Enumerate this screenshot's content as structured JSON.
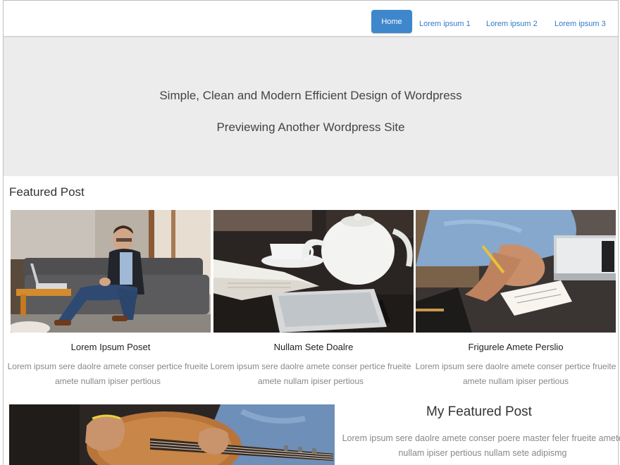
{
  "nav": {
    "home": "Home",
    "links": [
      "Lorem ipsum  1",
      "Lorem ipsum  2",
      "Lorem ipsum  3"
    ]
  },
  "hero": {
    "title": "Simple, Clean and Modern Efficient Design of Wordpress",
    "subtitle": "Previewing Another Wordpress Site"
  },
  "featured": {
    "heading": "Featured Post",
    "cards": [
      {
        "image": "man-on-sofa-with-laptop",
        "title": "Lorem Ipsum Poset",
        "text": "Lorem ipsum sere daolre amete conser pertice frueite amete nullam ipiser pertious"
      },
      {
        "image": "teapot-notebook-tablet",
        "title": "Nullam Sete Doalre",
        "text": "Lorem ipsum sere daolre amete conser pertice frueite amete nullam ipiser pertious"
      },
      {
        "image": "hand-writing-notes",
        "title": "Frigurele Amete Perslio",
        "text": "Lorem ipsum sere daolre amete conser pertice frueite amete nullam ipiser pertious"
      }
    ]
  },
  "my_featured": {
    "image": "guitar-player",
    "title": "My Featured Post",
    "text": "Lorem ipsum sere daolre amete conser poere master feler frueite amete nullam ipiser pertious nullam sete adipismg"
  }
}
